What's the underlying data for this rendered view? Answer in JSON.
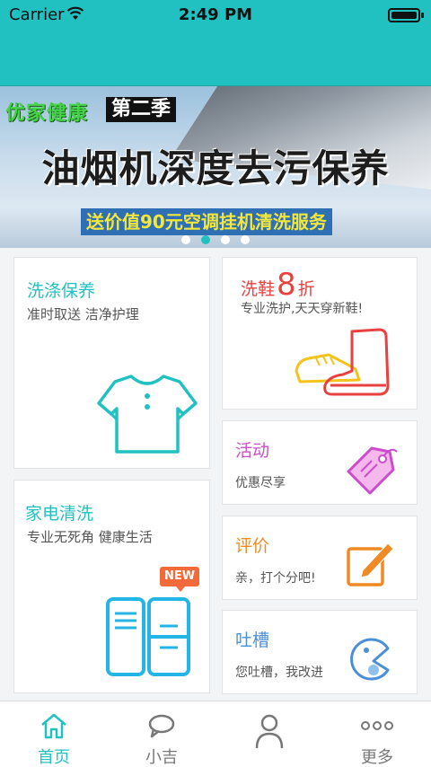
{
  "status_bar": {
    "carrier": "Carrier",
    "time": "2:49 PM"
  },
  "banner": {
    "tag_left": "优家健康",
    "tag_right": "第二季",
    "headline": "油烟机深度去污保养",
    "promo": "送价值90元空调挂机清洗服务",
    "pages": 4,
    "active_page": 2
  },
  "cards": {
    "laundry": {
      "title": "洗涤保养",
      "subtitle": "准时取送 洁净护理",
      "icon": "tshirt-icon"
    },
    "shoes": {
      "title_prefix": "洗鞋",
      "discount": "8",
      "title_suffix": "折",
      "subtitle": "专业洗护,天天穿新鞋!",
      "icon": "shoes-icon"
    },
    "appliance": {
      "title": "家电清洗",
      "subtitle": "专业无死角 健康生活",
      "badge": "NEW",
      "icon": "fridge-icon"
    },
    "activity": {
      "title": "活动",
      "subtitle": "优惠尽享",
      "icon": "price-tag-icon"
    },
    "rating": {
      "title": "评价",
      "subtitle": "亲，打个分吧!",
      "icon": "edit-icon"
    },
    "complaint": {
      "title": "吐槽",
      "subtitle": "您吐槽，我改进",
      "icon": "chat-face-icon"
    }
  },
  "colors": {
    "accent": "#22c1c1",
    "laundry": "#22c1c1",
    "shoes": "#e8413f",
    "activity": "#cc4dcc",
    "rating": "#f08a24",
    "complaint": "#4a90d9"
  },
  "tabbar": [
    {
      "label": "首页",
      "icon": "home-icon",
      "active": true
    },
    {
      "label": "小吉",
      "icon": "chat-bubble-icon",
      "active": false
    },
    {
      "label": "",
      "icon": "profile-icon",
      "active": false
    },
    {
      "label": "更多",
      "icon": "more-icon",
      "active": false
    }
  ]
}
